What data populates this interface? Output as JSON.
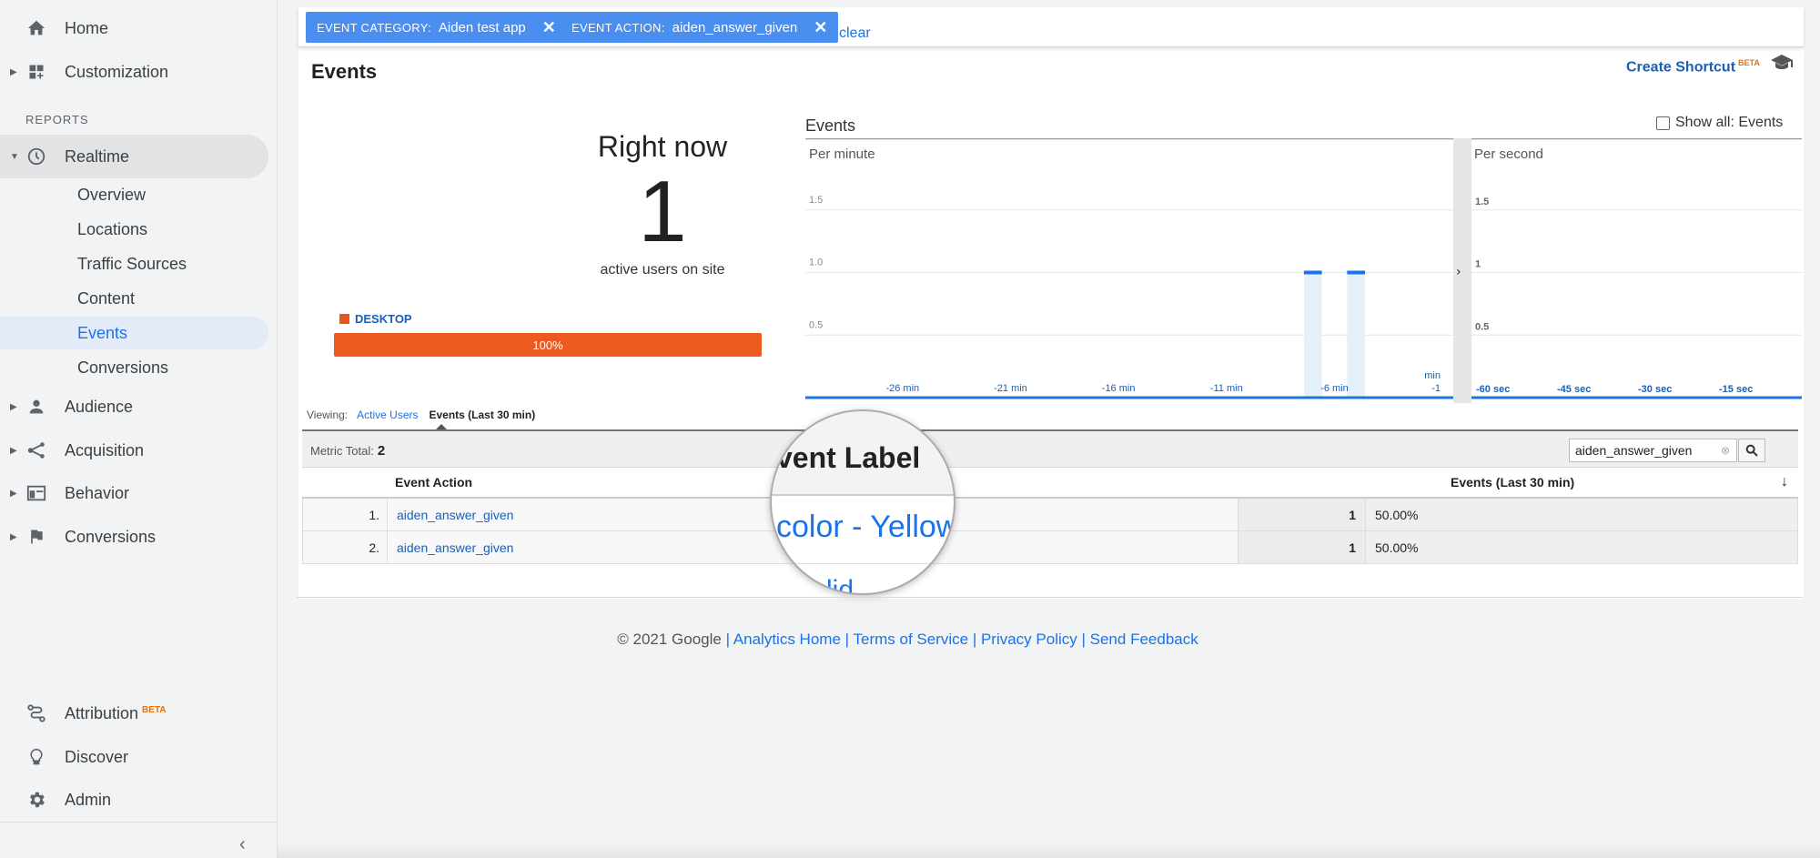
{
  "sidebar": {
    "home": "Home",
    "customization": "Customization",
    "reports_label": "REPORTS",
    "realtime": "Realtime",
    "realtime_items": [
      "Overview",
      "Locations",
      "Traffic Sources",
      "Content",
      "Events",
      "Conversions"
    ],
    "audience": "Audience",
    "acquisition": "Acquisition",
    "behavior": "Behavior",
    "conversions": "Conversions",
    "attribution": "Attribution",
    "attribution_badge": "BETA",
    "discover": "Discover",
    "admin": "Admin"
  },
  "filters": [
    {
      "key": "EVENT CATEGORY:",
      "value": "Aiden test app"
    },
    {
      "key": "EVENT ACTION:",
      "value": "aiden_answer_given"
    }
  ],
  "clear_label": "clear",
  "page_title": "Events",
  "create_shortcut": "Create Shortcut",
  "create_shortcut_badge": "BETA",
  "right_now": {
    "title": "Right now",
    "count": "1",
    "subtitle": "active users on site",
    "device_label": "DESKTOP",
    "device_percent": "100%",
    "device_fraction": 1.0,
    "device_color": "#ec5a20"
  },
  "chart": {
    "title": "Events",
    "show_all_label": "Show all: Events",
    "per_minute_label": "Per minute",
    "per_second_label": "Per second"
  },
  "chart_data": [
    {
      "type": "bar",
      "title": "Per minute",
      "ylim": [
        0,
        2
      ],
      "y_ticks": [
        "0.5",
        "1.0",
        "1.5"
      ],
      "x_ticks": [
        "-26 min",
        "-21 min",
        "-16 min",
        "-11 min",
        "-6 min",
        "-1"
      ],
      "x_unit": "min",
      "x": [
        -30,
        -29,
        -28,
        -27,
        -26,
        -25,
        -24,
        -23,
        -22,
        -21,
        -20,
        -19,
        -18,
        -17,
        -16,
        -15,
        -14,
        -13,
        -12,
        -11,
        -10,
        -9,
        -8,
        -7,
        -6,
        -5,
        -4,
        -3,
        -2,
        -1
      ],
      "values": [
        0,
        0,
        0,
        0,
        0,
        0,
        0,
        0,
        0,
        0,
        0,
        0,
        0,
        0,
        0,
        0,
        0,
        0,
        0,
        0,
        0,
        0,
        0,
        1,
        0,
        1,
        0,
        0,
        0,
        0
      ],
      "color": "#1a73e8"
    },
    {
      "type": "bar",
      "title": "Per second",
      "ylim": [
        0,
        2
      ],
      "y_ticks": [
        "0.5",
        "1",
        "1.5"
      ],
      "x_ticks": [
        "-60 sec",
        "-45 sec",
        "-30 sec",
        "-15 sec"
      ],
      "values": []
    }
  ],
  "viewing": {
    "label": "Viewing:",
    "active_users": "Active Users",
    "events": "Events (Last 30 min)"
  },
  "metric_total": {
    "label": "Metric Total:",
    "value": "2"
  },
  "search_value": "aiden_answer_given",
  "table": {
    "col_action": "Event Action",
    "col_events": "Events (Last 30 min)",
    "rows": [
      {
        "idx": "1.",
        "action": "aiden_answer_given",
        "value": "1",
        "pct": "50.00%"
      },
      {
        "idx": "2.",
        "action": "aiden_answer_given",
        "value": "1",
        "pct": "50.00%"
      }
    ]
  },
  "magnifier": {
    "heading": "vent Label",
    "value": "color - Yellow",
    "partial": "lid"
  },
  "footer": {
    "copyright": "© 2021 Google",
    "links": [
      "Analytics Home",
      "Terms of Service",
      "Privacy Policy",
      "Send Feedback"
    ]
  }
}
